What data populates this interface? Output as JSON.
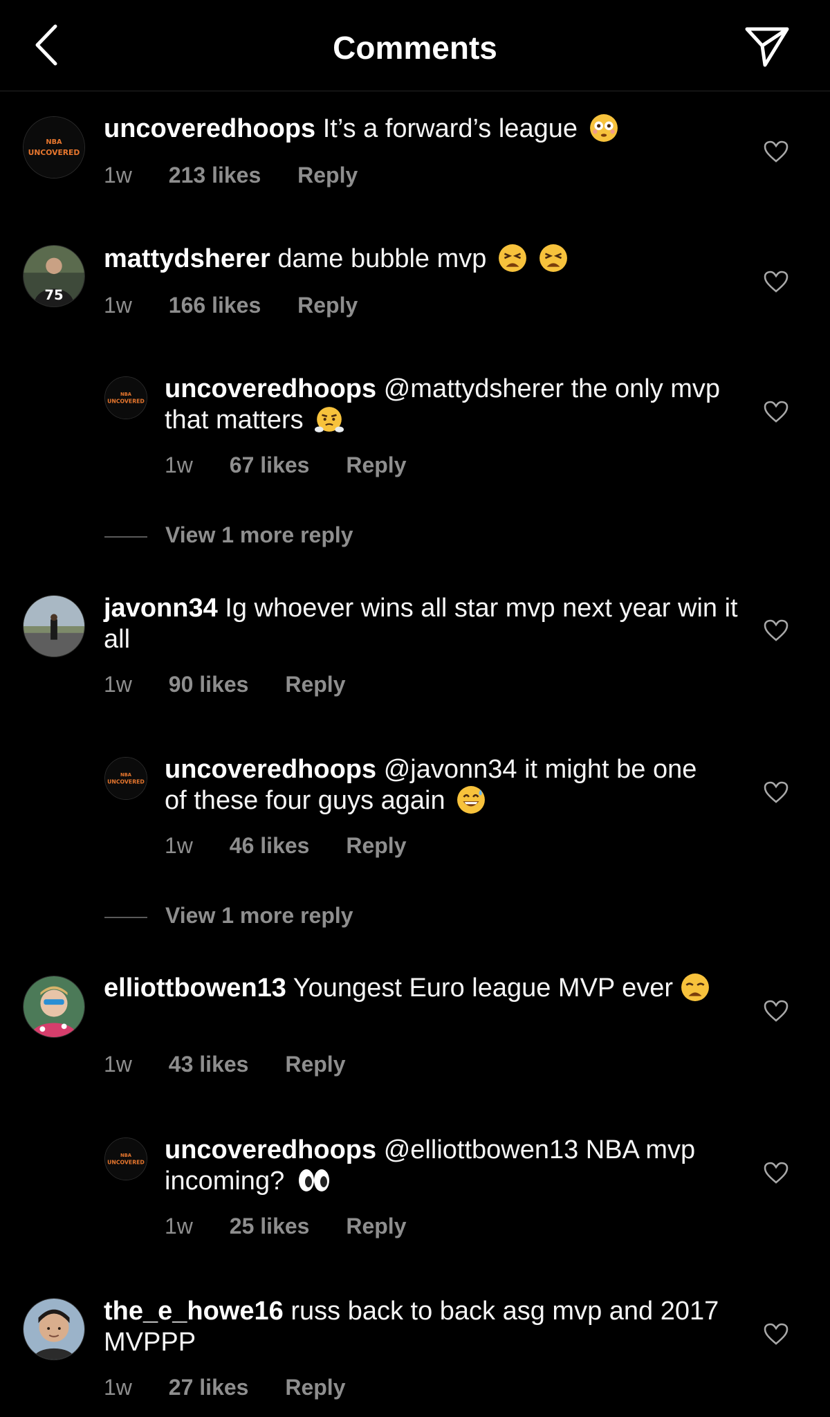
{
  "header": {
    "title": "Comments"
  },
  "comments": [
    {
      "username": "uncoveredhoops",
      "text": "It’s a forward’s league",
      "time": "1w",
      "likes": "213 likes",
      "reply": "Reply",
      "avatar_text_top": "NBA",
      "avatar_text_bottom": "UNCOVERED"
    },
    {
      "username": "mattydsherer",
      "text": "dame bubble mvp",
      "time": "1w",
      "likes": "166 likes",
      "reply": "Reply",
      "avatar_jersey": "75"
    },
    {
      "username": "uncoveredhoops",
      "text": "@mattydsherer the only mvp that matters",
      "time": "1w",
      "likes": "67 likes",
      "reply": "Reply",
      "avatar_text_top": "NBA",
      "avatar_text_bottom": "UNCOVERED"
    },
    {
      "username": "javonn34",
      "text": "Ig whoever wins all star mvp next year win it all",
      "time": "1w",
      "likes": "90 likes",
      "reply": "Reply"
    },
    {
      "username": "uncoveredhoops",
      "text": "@javonn34 it might be one of these four guys again",
      "time": "1w",
      "likes": "46 likes",
      "reply": "Reply",
      "avatar_text_top": "NBA",
      "avatar_text_bottom": "UNCOVERED"
    },
    {
      "username": "elliottbowen13",
      "text": "Youngest Euro league MVP ever",
      "time": "1w",
      "likes": "43 likes",
      "reply": "Reply"
    },
    {
      "username": "uncoveredhoops",
      "text": "@elliottbowen13 NBA mvp incoming?",
      "time": "1w",
      "likes": "25 likes",
      "reply": "Reply",
      "avatar_text_top": "NBA",
      "avatar_text_bottom": "UNCOVERED"
    },
    {
      "username": "the_e_howe16",
      "text": "russ back to back asg mvp and 2017 MVPPP",
      "time": "1w",
      "likes": "27 likes",
      "reply": "Reply"
    }
  ],
  "view_more": [
    {
      "label": "View 1 more reply"
    },
    {
      "label": "View 1 more reply"
    }
  ],
  "colors": {
    "background": "#000000",
    "secondary_text": "#8e8e8e",
    "brand_orange": "#e8772e"
  }
}
